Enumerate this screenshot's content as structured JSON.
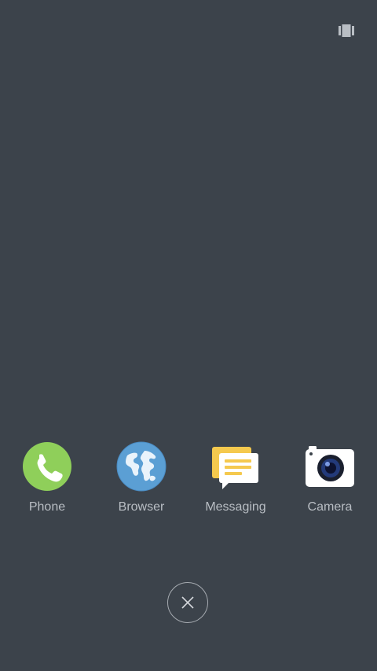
{
  "apps": [
    {
      "label": "Phone",
      "icon": "phone-icon",
      "color": "#8fcf5a"
    },
    {
      "label": "Browser",
      "icon": "globe-icon",
      "color": "#5b9fd4"
    },
    {
      "label": "Messaging",
      "icon": "message-icon",
      "color": "#f5c94e"
    },
    {
      "label": "Camera",
      "icon": "camera-icon",
      "color": "#ffffff"
    }
  ],
  "toolbar": {
    "recents_toggle_icon": "card-view-icon",
    "close_icon": "close-icon"
  },
  "colors": {
    "background": "#3c434b",
    "label": "#b9bec4"
  }
}
